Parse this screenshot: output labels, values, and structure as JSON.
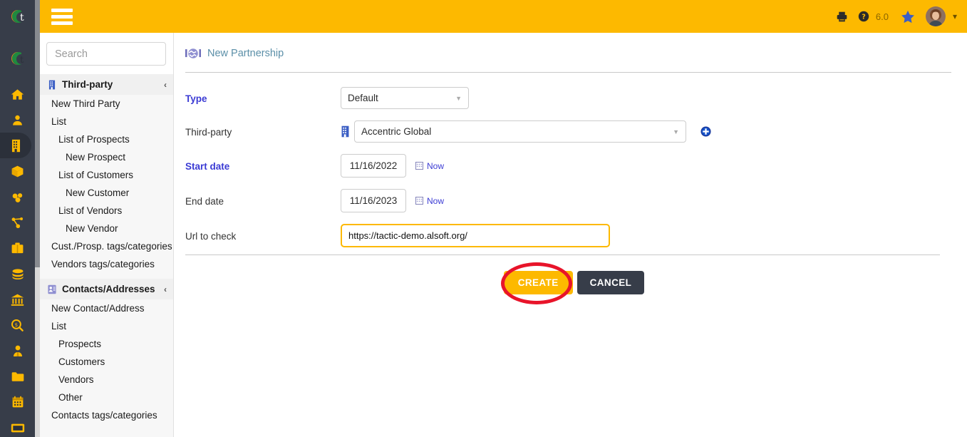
{
  "header": {
    "hamburger": "menu-icon",
    "print_icon": "printer-icon",
    "help_icon": "help-circle-icon",
    "version": "6.0",
    "star_icon": "star-icon",
    "avatar": "user-avatar",
    "chevron": "chevron-down-icon"
  },
  "search": {
    "placeholder": "Search",
    "value": ""
  },
  "sidebar": {
    "rail_icons": [
      {
        "name": "home-icon",
        "label": "Home"
      },
      {
        "name": "user-icon",
        "label": "Members"
      },
      {
        "name": "building-icon",
        "label": "Third parties",
        "active": true
      },
      {
        "name": "box-icon",
        "label": "Products"
      },
      {
        "name": "warehouse-icon",
        "label": "Stock"
      },
      {
        "name": "share-nodes-icon",
        "label": "Projects"
      },
      {
        "name": "briefcase-icon",
        "label": "Commercial"
      },
      {
        "name": "money-bills-icon",
        "label": "Billing"
      },
      {
        "name": "bank-icon",
        "label": "Bank"
      },
      {
        "name": "money-search-icon",
        "label": "Accounting"
      },
      {
        "name": "user-tie-icon",
        "label": "HRM"
      },
      {
        "name": "folder-icon",
        "label": "Documents"
      },
      {
        "name": "calendar-icon",
        "label": "Agenda"
      },
      {
        "name": "ticket-icon",
        "label": "Ticket"
      }
    ],
    "sections": [
      {
        "icon": "building-icon",
        "title": "Third-party",
        "collapse_arrow": "‹",
        "items": [
          {
            "label": "New Third Party",
            "level": 1
          },
          {
            "label": "List",
            "level": 1
          },
          {
            "label": "List of Prospects",
            "level": 2
          },
          {
            "label": "New Prospect",
            "level": 3
          },
          {
            "label": "List of Customers",
            "level": 2
          },
          {
            "label": "New Customer",
            "level": 3
          },
          {
            "label": "List of Vendors",
            "level": 2
          },
          {
            "label": "New Vendor",
            "level": 3
          },
          {
            "label": "Cust./Prosp. tags/categories",
            "level": 1
          },
          {
            "label": "Vendors tags/categories",
            "level": 1
          }
        ]
      },
      {
        "icon": "contact-card-icon",
        "title": "Contacts/Addresses",
        "collapse_arrow": "‹",
        "items": [
          {
            "label": "New Contact/Address",
            "level": 1
          },
          {
            "label": "List",
            "level": 1
          },
          {
            "label": "Prospects",
            "level": 2
          },
          {
            "label": "Customers",
            "level": 2
          },
          {
            "label": "Vendors",
            "level": 2
          },
          {
            "label": "Other",
            "level": 2
          },
          {
            "label": "Contacts tags/categories",
            "level": 1
          }
        ]
      }
    ]
  },
  "main": {
    "page_icon": "handshake-icon",
    "page_title": "New Partnership",
    "fields": {
      "type": {
        "label": "Type",
        "required": true,
        "value": "Default",
        "options": [
          "Default"
        ]
      },
      "third_party": {
        "label": "Third-party",
        "required": false,
        "icon": "building-icon",
        "value": "Accentric Global",
        "add_button": "plus-circle-icon"
      },
      "start_date": {
        "label": "Start date",
        "required": true,
        "value": "11/16/2022",
        "now_label": "Now",
        "calendar_icon": "calendar-small-icon"
      },
      "end_date": {
        "label": "End date",
        "required": false,
        "value": "11/16/2023",
        "now_label": "Now",
        "calendar_icon": "calendar-small-icon"
      },
      "url_to_check": {
        "label": "Url to check",
        "required": false,
        "value": "https://tactic-demo.alsoft.org/",
        "placeholder": ""
      }
    },
    "buttons": {
      "create": "CREATE",
      "cancel": "CANCEL"
    }
  },
  "colors": {
    "brand_yellow": "#fdb900",
    "dark_navy": "#373d49",
    "link_blue": "#3b3bd4",
    "title_teal": "#5b8fa8",
    "annotation_red": "#e8142a"
  }
}
